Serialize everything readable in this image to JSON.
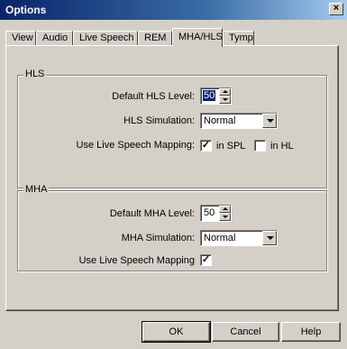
{
  "window": {
    "title": "Options",
    "close_glyph": "×",
    "close_icon": "close-icon"
  },
  "tabs": [
    {
      "label": "View",
      "active": false
    },
    {
      "label": "Audio",
      "active": false
    },
    {
      "label": "Live Speech",
      "active": false
    },
    {
      "label": "REM",
      "active": false
    },
    {
      "label": "MHA/HLS",
      "active": true
    },
    {
      "label": "Tymp",
      "active": false
    }
  ],
  "hls": {
    "legend": "HLS",
    "level_label": "Default HLS Level:",
    "level_value": "50",
    "simulation_label": "HLS Simulation:",
    "simulation_value": "Normal",
    "mapping_label": "Use Live Speech Mapping:",
    "spl_label": "in SPL",
    "spl_checked": true,
    "hl_label": "in HL",
    "hl_checked": false
  },
  "mha": {
    "legend": "MHA",
    "level_label": "Default MHA Level:",
    "level_value": "50",
    "simulation_label": "MHA Simulation:",
    "simulation_value": "Normal",
    "mapping_label": "Use Live Speech Mapping",
    "mapping_checked": true
  },
  "buttons": {
    "ok": "OK",
    "cancel": "Cancel",
    "help": "Help"
  },
  "check_glyph": "✓"
}
